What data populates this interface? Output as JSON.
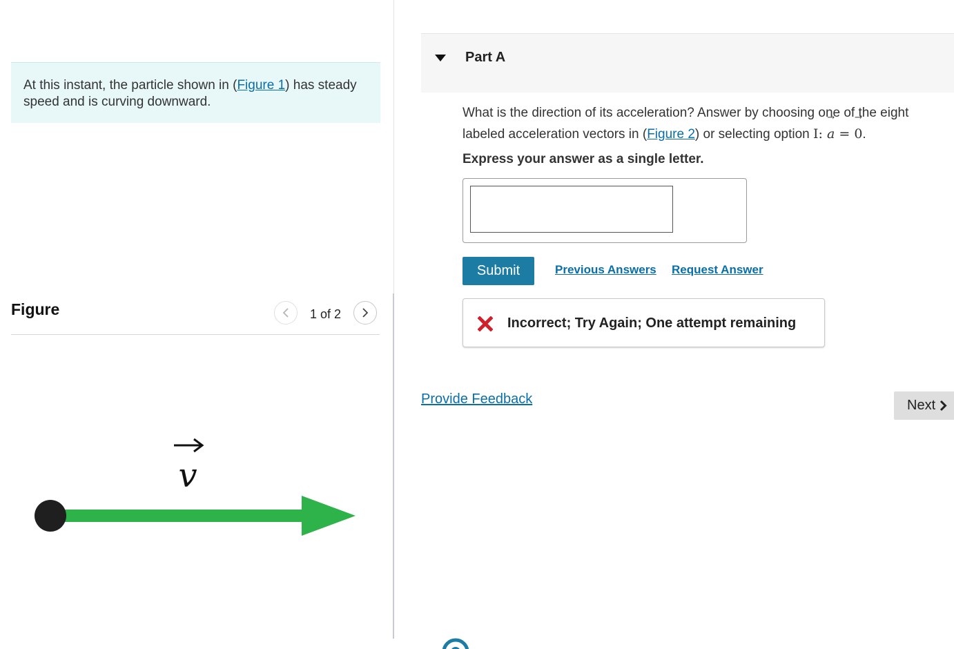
{
  "intro": {
    "before": "At this instant, the particle shown in (",
    "link": "Figure 1",
    "after": ") has steady speed and is curving downward."
  },
  "figure_panel": {
    "title": "Figure",
    "counter": "1 of 2",
    "vector_label": "v"
  },
  "part": {
    "title": "Part A",
    "question_before": "What is the direction of its acceleration? Answer by choosing one of the eight labeled acceleration vectors in (",
    "question_link": "Figure 2",
    "question_after": ") or selecting option ",
    "option_letter": "I",
    "option_math_a": "a",
    "option_math_eq": "=",
    "option_math_zero": "0",
    "instruction": "Express your answer as a single letter.",
    "answer_value": ""
  },
  "actions": {
    "submit": "Submit",
    "previous_answers": "Previous Answers",
    "request_answer": "Request Answer"
  },
  "feedback": {
    "message": "Incorrect; Try Again; One attempt remaining"
  },
  "footer": {
    "provide_feedback": "Provide Feedback",
    "next": "Next"
  },
  "colors": {
    "accent": "#1c7ca3",
    "link": "#0a6ea8",
    "intro_bg": "#e8f7f7",
    "error": "#d0202a",
    "vector_green": "#2db34a"
  },
  "icons": [
    "caret-down-icon",
    "chevron-left-icon",
    "chevron-right-icon",
    "x-mark-icon",
    "logo-icon"
  ]
}
